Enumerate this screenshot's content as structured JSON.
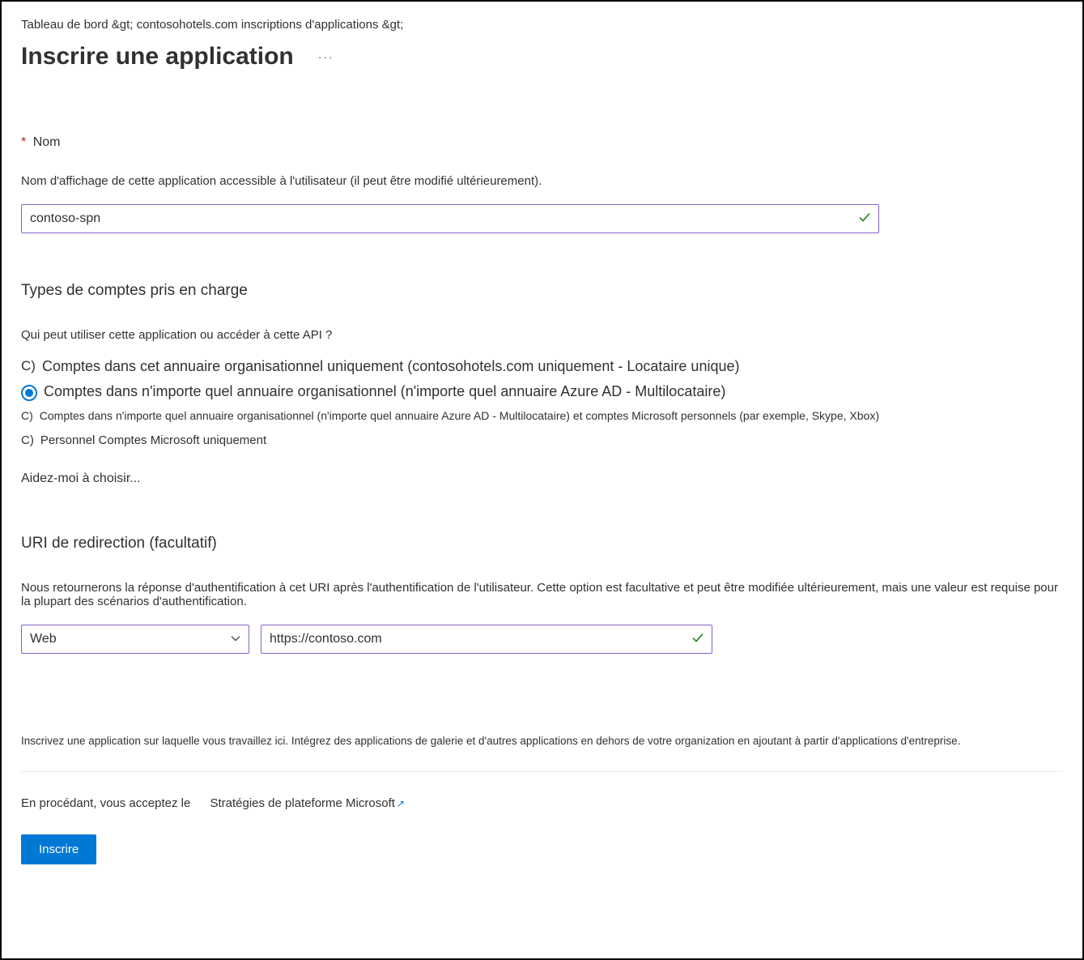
{
  "breadcrumb": "Tableau de bord &gt; contosohotels.com inscriptions d'applications &gt;",
  "page_title": "Inscrire une application",
  "more_dots": "···",
  "name_section": {
    "label": "Nom",
    "desc": "Nom d'affichage de cette application accessible à l'utilisateur (il peut être modifié ultérieurement).",
    "value": "contoso-spn"
  },
  "account_types": {
    "heading": "Types de comptes pris en charge",
    "question": "Qui peut utiliser cette application ou accéder à cette API ?",
    "options": [
      {
        "prefix": "C)",
        "label": "Comptes dans cet annuaire organisationnel uniquement (contosohotels.com uniquement - Locataire unique)"
      },
      {
        "prefix": "",
        "label": "Comptes dans n'importe quel annuaire organisationnel (n'importe quel annuaire Azure AD - Multilocataire)"
      },
      {
        "prefix": "C)",
        "label": "Comptes dans n'importe quel annuaire organisationnel (n'importe quel annuaire Azure AD - Multilocataire) et comptes Microsoft personnels (par exemple, Skype, Xbox)"
      },
      {
        "prefix": "C)",
        "label": "Personnel   Comptes Microsoft uniquement"
      }
    ],
    "help_link": "Aidez-moi à choisir..."
  },
  "redirect": {
    "heading": "URI de redirection (facultatif)",
    "desc": "Nous retournerons la réponse d'authentification à cet URI après l'authentification de l'utilisateur. Cette option est facultative et peut être modifiée ultérieurement, mais une valeur est requise pour la plupart des scénarios d'authentification.",
    "platform": "Web",
    "url": "https://contoso.com"
  },
  "note": "Inscrivez une application sur laquelle vous travaillez ici. Intégrez des applications de galerie et d'autres applications en dehors de votre organization en ajoutant à partir d'applications d'entreprise.",
  "policy": {
    "prefix": "En procédant, vous acceptez le",
    "link": "Stratégies de plateforme Microsoft"
  },
  "register_button": "Inscrire"
}
